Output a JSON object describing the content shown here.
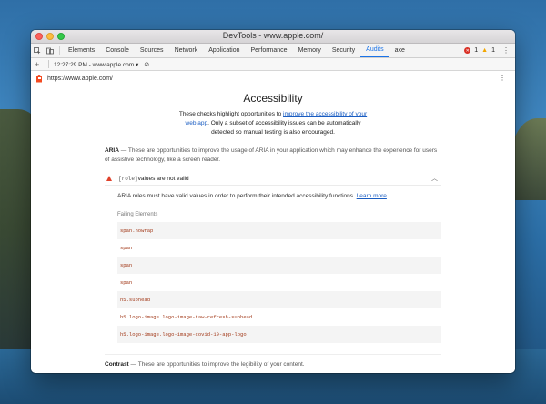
{
  "window": {
    "title": "DevTools - www.apple.com/"
  },
  "tabs": [
    "Elements",
    "Console",
    "Sources",
    "Network",
    "Application",
    "Performance",
    "Memory",
    "Security",
    "Audits",
    "axe"
  ],
  "active_tab": "Audits",
  "status": {
    "errors": "1",
    "warnings": "1"
  },
  "toolbar": {
    "report_label": "12:27:29 PM - www.apple.com ▾"
  },
  "urlbar": {
    "url": "https://www.apple.com/"
  },
  "report": {
    "title": "Accessibility",
    "desc_before": "These checks highlight opportunities to ",
    "desc_link": "improve the accessibility of your web app",
    "desc_after": ". Only a subset of accessibility issues can be automatically detected so manual testing is also encouraged.",
    "aria_title": "ARIA",
    "aria_desc": " — These are opportunities to improve the usage of ARIA in your application which may enhance the experience for users of assistive technology, like a screen reader.",
    "audit": {
      "code": "[role]",
      "title_rest": " values are not valid",
      "desc": "ARIA roles must have valid values in order to perform their intended accessibility functions. ",
      "learn_more": "Learn more",
      "desc_end": ".",
      "failing_label": "Failing Elements",
      "failing": [
        "span.nowrap",
        "span",
        "span",
        "span",
        "h5.subhead",
        "h5.logo-image.logo-image-taw-refresh-subhead",
        "h5.logo-image.logo-image-covid-19-app-logo"
      ]
    },
    "contrast_title": "Contrast",
    "contrast_desc": " — These are opportunities to improve the legibility of your content."
  }
}
